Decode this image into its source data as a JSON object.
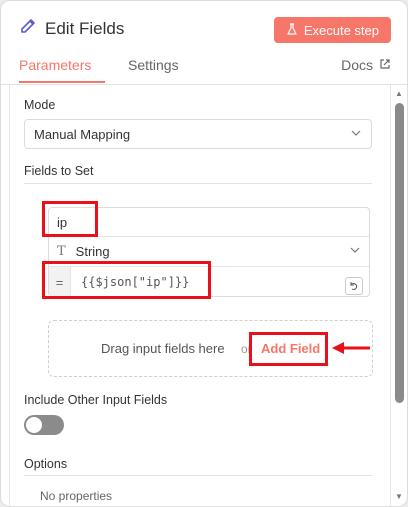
{
  "header": {
    "title": "Edit Fields",
    "execute_label": "Execute step",
    "pencil_icon": "pencil-icon",
    "flask_icon": "flask-icon"
  },
  "tabs": [
    {
      "label": "Parameters",
      "active": true
    },
    {
      "label": "Settings",
      "active": false
    },
    {
      "label": "Docs",
      "active": false,
      "icon": "external-link-icon"
    }
  ],
  "params": {
    "mode_label": "Mode",
    "mode_value": "Manual Mapping",
    "fields_label": "Fields to Set",
    "field": {
      "name": "ip",
      "type": "String",
      "expression_prefix": "=",
      "expression": "{{$json[\"ip\"]}}"
    },
    "drop_text": "Drag input fields here",
    "drop_or": "or",
    "add_field_label": "Add Field",
    "include_label": "Include Other Input Fields",
    "include_enabled": false,
    "options_label": "Options",
    "no_properties": "No properties"
  },
  "colors": {
    "accent": "#f7766a",
    "annotation": "#e8101a",
    "toggle_off": "#8b8b8b"
  }
}
